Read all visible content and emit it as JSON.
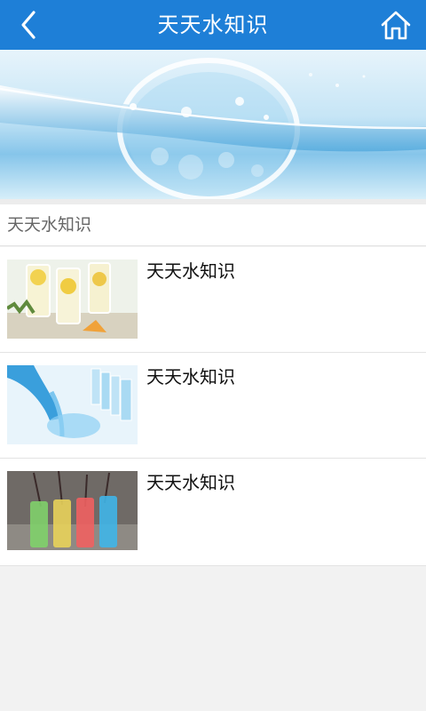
{
  "header": {
    "title": "天天水知识",
    "back_icon": "chevron-left-icon",
    "home_icon": "home-icon",
    "color": "#1e7fd7"
  },
  "banner": {
    "image": "water-splash-glass-banner"
  },
  "section": {
    "title": "天天水知识"
  },
  "list": {
    "items": [
      {
        "title": "天天水知识",
        "image": "lemon-water-glasses-thumbnail"
      },
      {
        "title": "天天水知识",
        "image": "pouring-water-glasses-thumbnail"
      },
      {
        "title": "天天水知识",
        "image": "colorful-drinks-thumbnail"
      }
    ]
  }
}
